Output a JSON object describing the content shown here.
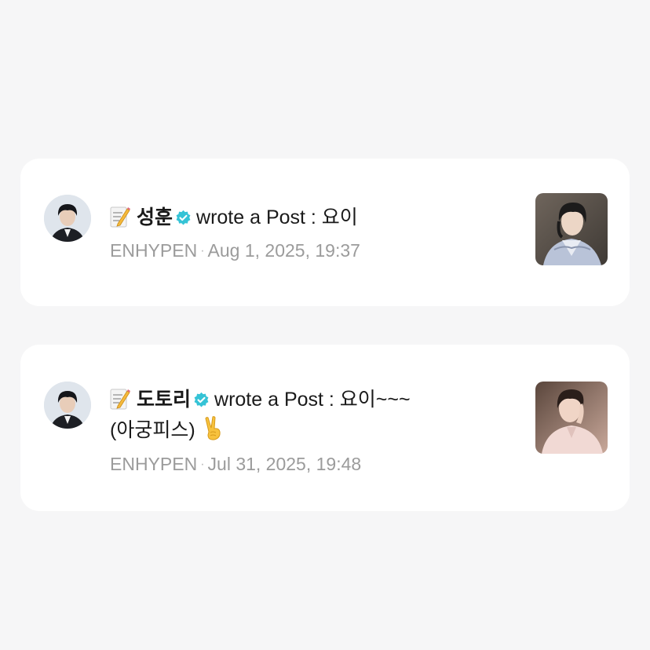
{
  "notifications": [
    {
      "icon": "memo-icon",
      "author": "성훈",
      "verified": true,
      "action": "wrote a Post : 요이",
      "action_continued": "",
      "has_peace_emoji": false,
      "group": "ENHYPEN",
      "separator": "·",
      "timestamp": "Aug 1, 2025, 19:37"
    },
    {
      "icon": "memo-icon",
      "author": "도토리",
      "verified": true,
      "action": "wrote a Post : 요이~~~",
      "action_continued": "(아궁피스)",
      "has_peace_emoji": true,
      "group": "ENHYPEN",
      "separator": "·",
      "timestamp": "Jul 31, 2025, 19:48"
    }
  ],
  "colors": {
    "background": "#f6f6f7",
    "card": "#ffffff",
    "verified_badge": "#35c3d6",
    "meta_text": "#9b9b9b",
    "primary_text": "#1a1a1a"
  }
}
